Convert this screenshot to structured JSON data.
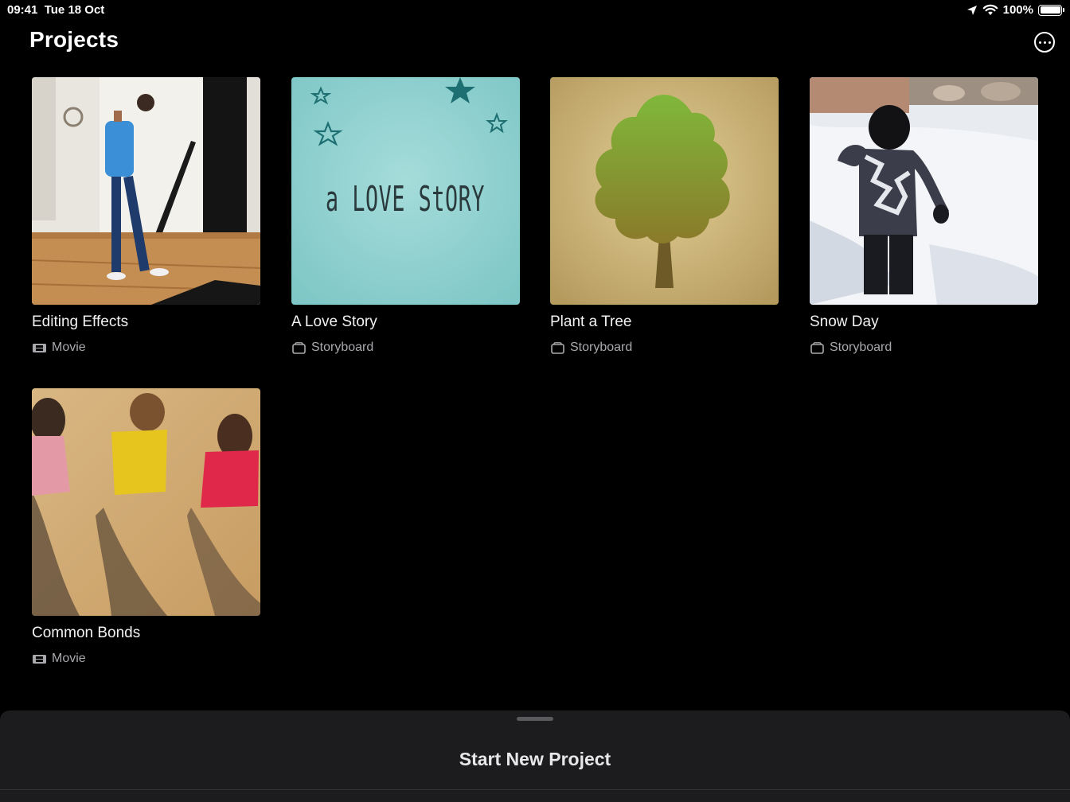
{
  "status": {
    "time": "09:41",
    "date": "Tue 18 Oct",
    "battery": "100%",
    "battery_level": 1.0,
    "icons": [
      "location-icon",
      "wifi-icon",
      "battery-icon"
    ]
  },
  "header": {
    "title": "Projects",
    "more_icon": "ellipsis-circle-icon"
  },
  "projects": [
    {
      "title": "Editing Effects",
      "type": "Movie",
      "type_icon": "film-icon"
    },
    {
      "title": "A Love Story",
      "type": "Storyboard",
      "type_icon": "storyboard-icon",
      "thumb_text": "a LOVE StORY"
    },
    {
      "title": "Plant a Tree",
      "type": "Storyboard",
      "type_icon": "storyboard-icon"
    },
    {
      "title": "Snow Day",
      "type": "Storyboard",
      "type_icon": "storyboard-icon"
    },
    {
      "title": "Common Bonds",
      "type": "Movie",
      "type_icon": "film-icon"
    }
  ],
  "bottom_sheet": {
    "start_label": "Start New Project"
  },
  "colors": {
    "background": "#000000",
    "sheet": "#1c1c1e",
    "secondary_text": "#a9a9ad",
    "love_story_bg": "#8fd3d2",
    "tree_bg": "#cbb57c"
  }
}
